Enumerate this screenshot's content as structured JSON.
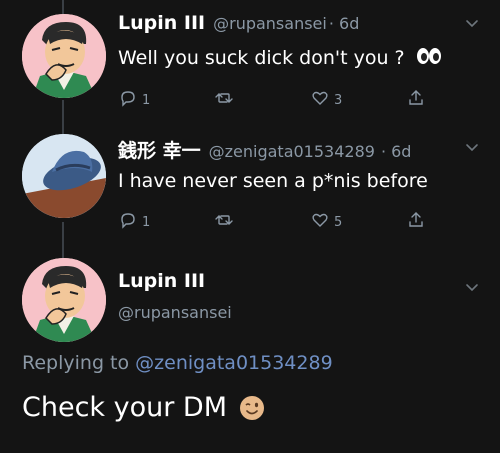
{
  "tweets": [
    {
      "name": "Lupin III",
      "handle": "@rupansansei",
      "time": "· 6d",
      "text": "Well you suck dick don't you ?",
      "emoji": "eyes-emoji",
      "replies": "1",
      "retweets": "",
      "likes": "3"
    },
    {
      "name": "銭形 幸一",
      "handle": "@zenigata01534289",
      "time": "· 6d",
      "text": "I have never seen a p*nis before",
      "replies": "1",
      "retweets": "",
      "likes": "5"
    }
  ],
  "main": {
    "name": "Lupin III",
    "handle": "@rupansansei",
    "replying_prefix": "Replying to",
    "replying_to": "@zenigata01534289",
    "text": "Check your DM",
    "emoji": "winking-face-emoji"
  },
  "colors": {
    "background": "#141414",
    "muted": "#8b98a5",
    "link": "#6f8fc4",
    "thread_line": "#3a3f45"
  },
  "icons": [
    "reply-icon",
    "retweet-icon",
    "like-icon",
    "share-icon",
    "chevron-down-icon"
  ]
}
